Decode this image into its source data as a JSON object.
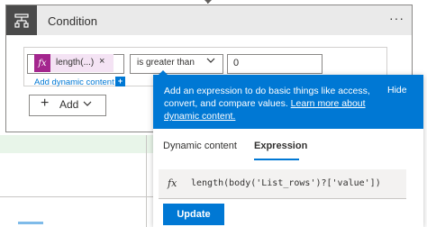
{
  "condition_card": {
    "title": "Condition",
    "icon": "condition-icon",
    "more_label": "···"
  },
  "row": {
    "left_operand": {
      "token_icon_label": "fx",
      "token_label": "length(...)",
      "remove_label": "×"
    },
    "operator": {
      "selected": "is greater than"
    },
    "right_operand": {
      "value": "0"
    },
    "add_dynamic_content_label": "Add dynamic content",
    "add_dynamic_badge": "+"
  },
  "add_button": {
    "plus": "+",
    "label": "Add"
  },
  "panel": {
    "banner": {
      "text": "Add an expression to do basic things like access, convert, and compare values.",
      "link_label": "Learn more about dynamic content.",
      "hide_label": "Hide"
    },
    "tabs": [
      {
        "label": "Dynamic content",
        "active": false
      },
      {
        "label": "Expression",
        "active": true
      }
    ],
    "expression": {
      "fx_label": "fx",
      "value": "length(body('List_rows')?['value'])"
    },
    "update_label": "Update"
  },
  "colors": {
    "accent": "#0078d4",
    "token_purple": "#a4268e",
    "header_dark": "#4a4a4a"
  }
}
